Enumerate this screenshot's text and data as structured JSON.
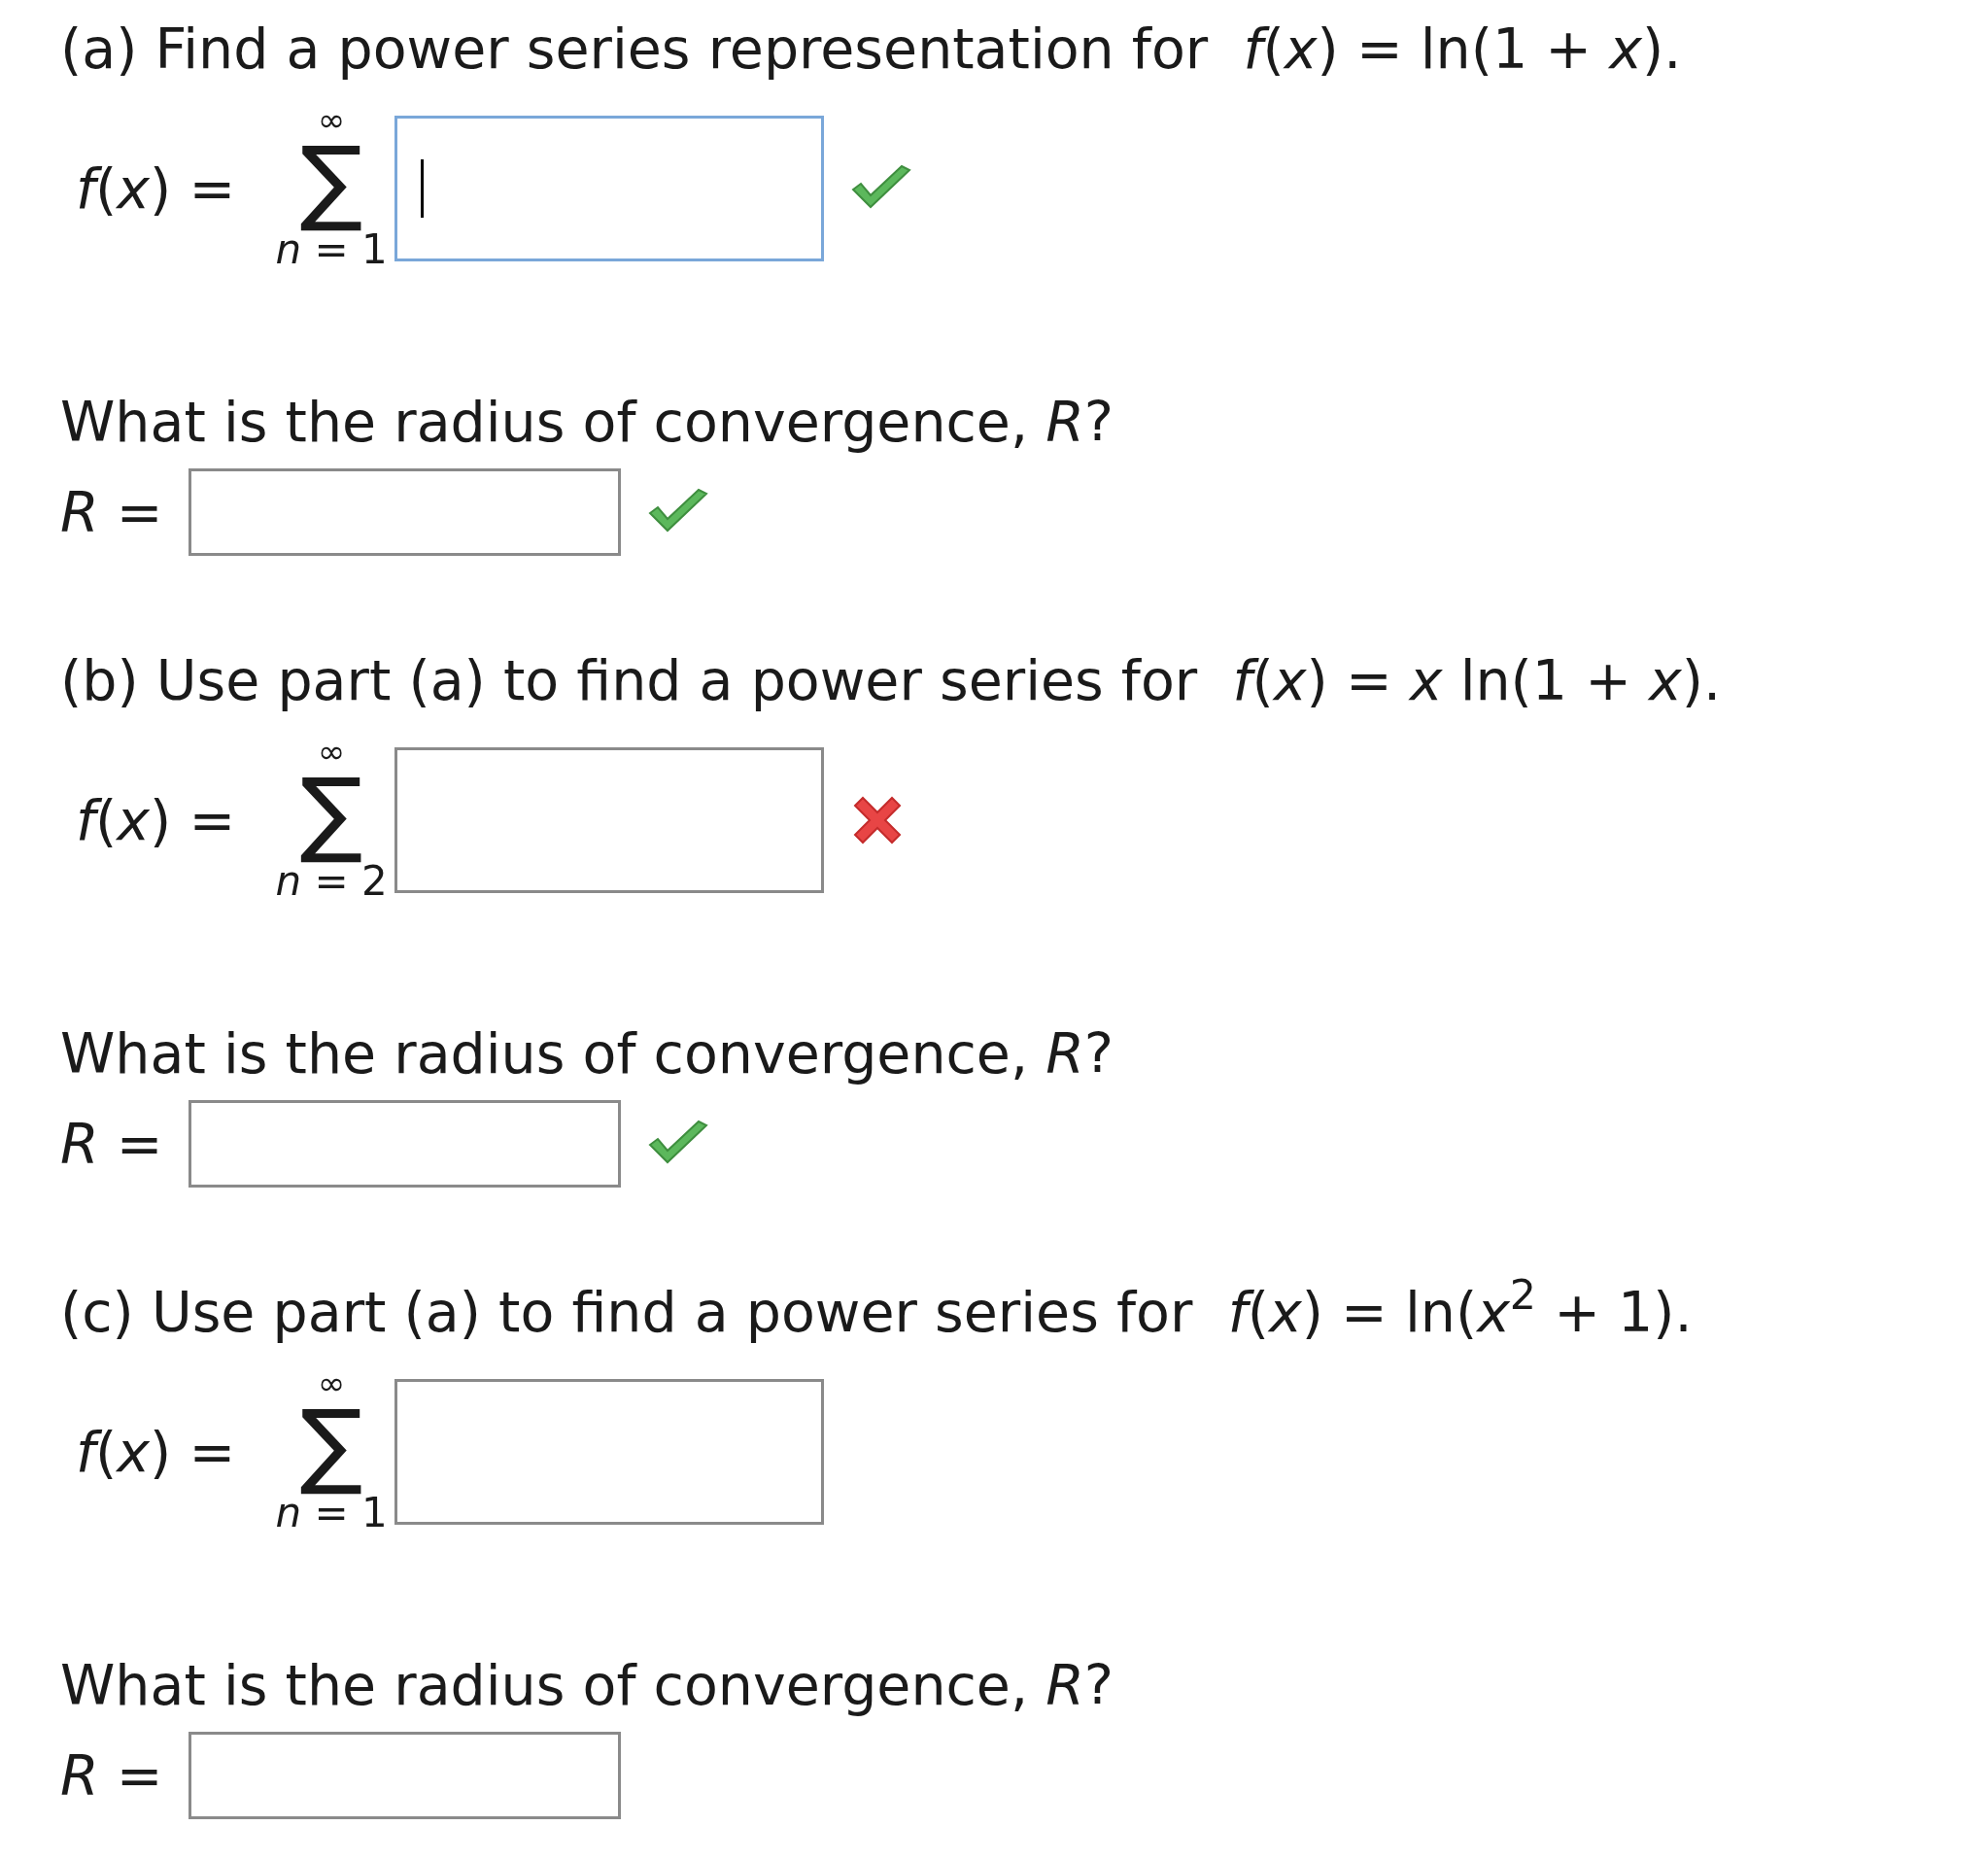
{
  "parts": [
    {
      "title": "(a) Find a power series representation for  *f*(*x*) = ln(1 + *x*).",
      "series": {
        "lhs": "*f*(*x*) =",
        "upper": "∞",
        "symbol": "∑",
        "lower": "*n* = 1",
        "focused": true,
        "correct": true
      },
      "radius": {
        "question": "What is the radius of convergence, *R*?",
        "label": "*R* =",
        "focused": false,
        "correct": true
      }
    },
    {
      "title": "(b) Use part (a) to find a power series for  *f*(*x*) = *x* ln(1 + *x*).",
      "series": {
        "lhs": "*f*(*x*) =",
        "upper": "∞",
        "symbol": "∑",
        "lower": "*n* = 2",
        "focused": false,
        "correct": false
      },
      "radius": {
        "question": "What is the radius of convergence, *R*?",
        "label": "*R* =",
        "focused": false,
        "correct": true
      }
    },
    {
      "title": "(c) Use part (a) to find a power series for  *f*(*x*) = ln(*x*$^{2}$ + 1).",
      "series": {
        "lhs": "*f*(*x*) =",
        "upper": "∞",
        "symbol": "∑",
        "lower": "*n* = 1",
        "focused": false
      },
      "radius": {
        "question": "What is the radius of convergence, *R*?",
        "label": "*R* =",
        "focused": false
      }
    }
  ]
}
